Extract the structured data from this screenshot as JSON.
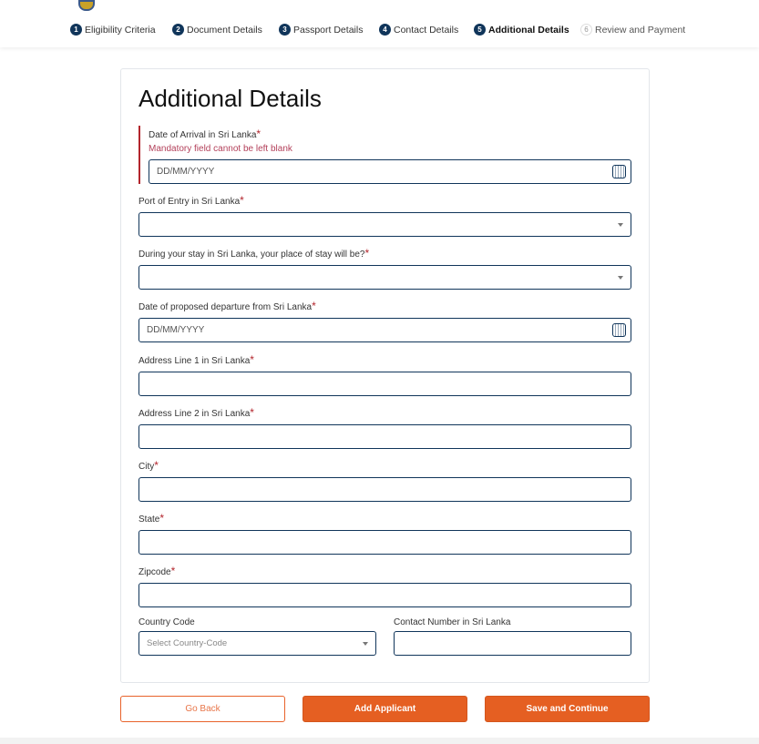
{
  "steps": [
    {
      "num": "1",
      "label": "Eligibility Criteria",
      "state": "done"
    },
    {
      "num": "2",
      "label": "Document Details",
      "state": "done"
    },
    {
      "num": "3",
      "label": "Passport Details",
      "state": "done"
    },
    {
      "num": "4",
      "label": "Contact Details",
      "state": "done"
    },
    {
      "num": "5",
      "label": "Additional Details",
      "state": "active"
    },
    {
      "num": "6",
      "label": "Review and Payment",
      "state": "pending"
    }
  ],
  "form": {
    "title": "Additional Details",
    "required_mark": "*",
    "arrival": {
      "label": "Date of Arrival in Sri Lanka",
      "error": "Mandatory field cannot be left blank",
      "placeholder": "DD/MM/YYYY"
    },
    "port": {
      "label": "Port of Entry in Sri Lanka"
    },
    "stay": {
      "label": "During your stay in Sri Lanka, your place of stay will be?"
    },
    "departure": {
      "label": "Date of proposed departure from Sri Lanka",
      "placeholder": "DD/MM/YYYY"
    },
    "address1": {
      "label": "Address Line 1 in Sri Lanka"
    },
    "address2": {
      "label": "Address Line 2 in Sri Lanka"
    },
    "city": {
      "label": "City"
    },
    "state": {
      "label": "State"
    },
    "zipcode": {
      "label": "Zipcode"
    },
    "country_code": {
      "label": "Country Code",
      "placeholder": "Select Country-Code"
    },
    "contact": {
      "label": "Contact Number in Sri Lanka"
    }
  },
  "buttons": {
    "back": "Go Back",
    "add": "Add Applicant",
    "save": "Save and Continue"
  },
  "colors": {
    "primary": "#10355a",
    "accent": "#e55f22",
    "error": "#b3262d"
  }
}
